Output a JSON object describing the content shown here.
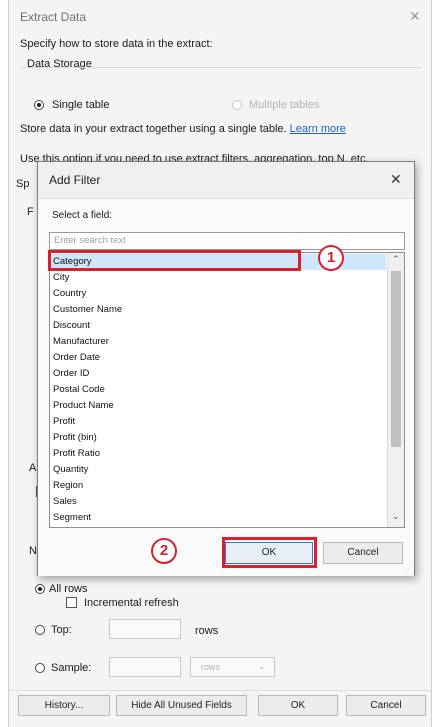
{
  "outer": {
    "title": "Extract Data",
    "intro": "Specify how to store data in the extract:",
    "data_storage_label": "Data Storage",
    "single_table": "Single table",
    "multiple_tables": "Multiple tables",
    "store_desc": "Store data in your extract together using a single table.",
    "learn_more": "Learn more",
    "use_option_text": "Use this option if you need to use extract filters, aggregation, top N, etc.",
    "spec_fragment": "Sp",
    "f_fragment": "F",
    "a_fragment": "A",
    "n_fragment": "N",
    "all_rows": "All rows",
    "incremental_refresh": "Incremental refresh",
    "top_label": "Top:",
    "rows_label": "rows",
    "sample_label": "Sample:",
    "sample_unit": "rows",
    "history_button": "History...",
    "hide_fields_button": "Hide All Unused Fields",
    "ok_button": "OK",
    "cancel_button": "Cancel"
  },
  "dialog": {
    "title": "Add Filter",
    "select_field_label": "Select a field:",
    "search_placeholder": "Enter search text",
    "fields": [
      "Category",
      "City",
      "Country",
      "Customer Name",
      "Discount",
      "Manufacturer",
      "Order Date",
      "Order ID",
      "Postal Code",
      "Product Name",
      "Profit",
      "Profit (bin)",
      "Profit Ratio",
      "Quantity",
      "Region",
      "Sales",
      "Segment"
    ],
    "selected_field": "Category",
    "ok_button": "OK",
    "cancel_button": "Cancel"
  },
  "annotations": {
    "step1": "1",
    "step2": "2"
  },
  "colors": {
    "annotation_red": "#d8202f",
    "selection_blue": "#cfe6fb",
    "link_blue": "#1f5fbf"
  },
  "icons": {
    "close": "close-icon",
    "scroll_up": "chevron-up-icon",
    "scroll_down": "chevron-down-icon",
    "dropdown": "chevron-down-icon"
  }
}
